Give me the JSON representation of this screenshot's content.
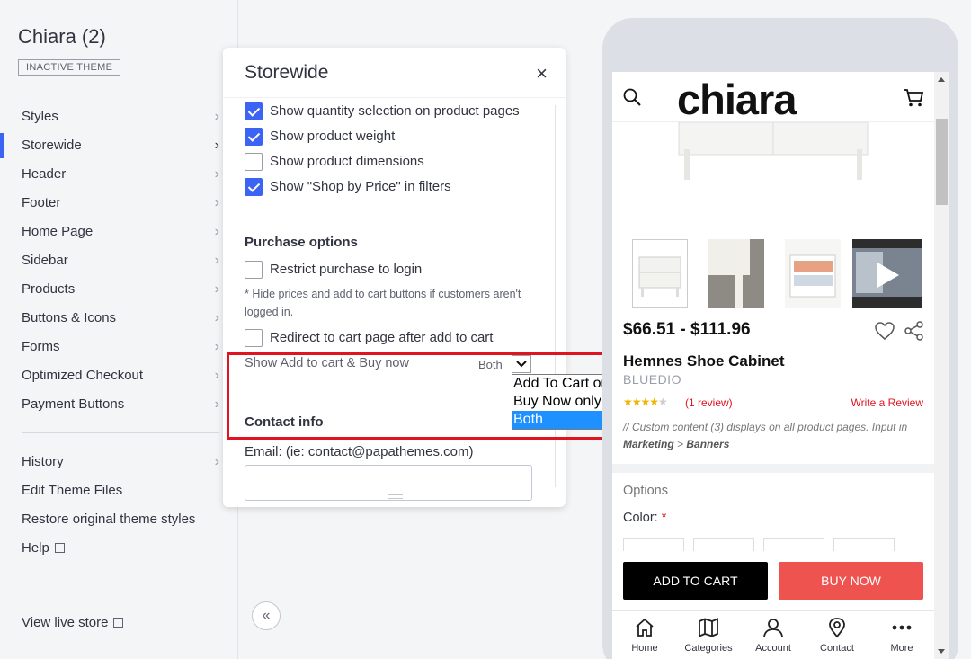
{
  "sidebar": {
    "title": "Chiara (2)",
    "badge": "INACTIVE THEME",
    "items": [
      {
        "label": "Styles"
      },
      {
        "label": "Storewide"
      },
      {
        "label": "Header"
      },
      {
        "label": "Footer"
      },
      {
        "label": "Home Page"
      },
      {
        "label": "Sidebar"
      },
      {
        "label": "Products"
      },
      {
        "label": "Buttons & Icons"
      },
      {
        "label": "Forms"
      },
      {
        "label": "Optimized Checkout"
      },
      {
        "label": "Payment Buttons"
      }
    ],
    "secondary": [
      {
        "label": "History"
      },
      {
        "label": "Edit Theme Files"
      },
      {
        "label": "Restore original theme styles"
      },
      {
        "label": "Help"
      }
    ],
    "live_store": "View live store",
    "accent": "#3c64f4"
  },
  "panel": {
    "title": "Storewide",
    "close": "×",
    "checkboxes": [
      {
        "label": "Show quantity selection on product pages",
        "checked": true
      },
      {
        "label": "Show product weight",
        "checked": true
      },
      {
        "label": "Show product dimensions",
        "checked": false
      },
      {
        "label": "Show \"Shop by Price\" in filters",
        "checked": true
      }
    ],
    "purchase_title": "Purchase options",
    "restrict_label": "Restrict purchase to login",
    "restrict_note": "* Hide prices and add to cart buttons if customers aren't logged in.",
    "redirect_label": "Redirect to cart page after add to cart",
    "select_label": "Show Add to cart & Buy now",
    "select_value": "Both",
    "select_options": [
      "Add To Cart only",
      "Buy Now only",
      "Both"
    ],
    "contact_title": "Contact info",
    "email_label": "Email: (ie: contact@papathemes.com)",
    "email_value": ""
  },
  "collapse_glyph": "«",
  "preview": {
    "logo": "chiara",
    "price": "$66.51 - $111.96",
    "product_name": "Hemnes Shoe Cabinet",
    "brand": "BLUEDIO",
    "rating": 4,
    "reviews": "(1 review)",
    "write_review": "Write a Review",
    "custom_text": "// Custom content (3) displays on all product pages. Input in",
    "custom_path_1": "Marketing",
    "custom_path_sep": " > ",
    "custom_path_2": "Banners",
    "options_title": "Options",
    "color_label": "Color:",
    "required_mark": "*",
    "add_to_cart": "ADD TO CART",
    "buy_now": "BUY NOW",
    "nav": [
      "Home",
      "Categories",
      "Account",
      "Contact",
      "More"
    ],
    "icons": [
      "search-icon",
      "cart-icon",
      "heart-icon",
      "share-icon",
      "home-icon",
      "map-icon",
      "user-icon",
      "location-pin-icon",
      "more-dots-icon"
    ],
    "buy_color": "#ef5350",
    "highlight_color": "#e0141e"
  }
}
